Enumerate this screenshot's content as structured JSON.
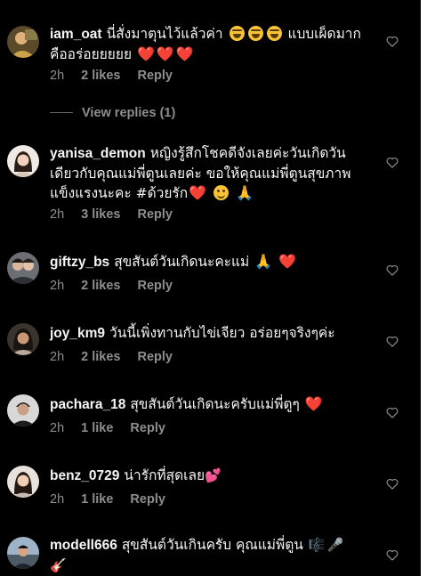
{
  "comments": [
    {
      "username": "iam_oat",
      "text_part1": "นี่สั่งมาตุนไว้แล้วค่า",
      "text_part2": "แบบเผ็ดมาก",
      "text_part3": "คืออร่อยยยยย",
      "time": "2h",
      "likes": "2 likes",
      "reply": "Reply",
      "emojis": [
        "laughing-face",
        "laughing-face",
        "laughing-face",
        "red-heart",
        "red-heart",
        "red-heart"
      ]
    },
    {
      "username": "yanisa_demon",
      "text_part1": "หญิงรู้สึกโชคดีจังเลยค่ะวันเกิดวันเดียวกับคุณแม่พี่ตูนเลยค่ะ ขอให้คุณแม่พี่ตูนสุขภาพแข็งแรงนะคะ #ด้วยรัก",
      "time": "2h",
      "likes": "3 likes",
      "reply": "Reply",
      "emojis": [
        "red-heart",
        "smiling-face",
        "folded-hands"
      ]
    },
    {
      "username": "giftzy_bs",
      "text_part1": "สุขสันต์วันเกิดนะคะแม่",
      "time": "2h",
      "likes": "2 likes",
      "reply": "Reply",
      "emojis": [
        "folded-hands",
        "red-heart"
      ]
    },
    {
      "username": "joy_km9",
      "text_part1": "วันนี้เพิ่งทานกับไข่เจียว อร่อยๆจริงๆค่ะ",
      "time": "2h",
      "likes": "2 likes",
      "reply": "Reply"
    },
    {
      "username": "pachara_18",
      "text_part1": "สุขสันต์วันเกิดนะครับแม่พี่ตูๆ",
      "time": "2h",
      "likes": "1 like",
      "reply": "Reply",
      "emojis": [
        "red-heart"
      ]
    },
    {
      "username": "benz_0729",
      "text_part1": "น่ารักที่สุดเลย",
      "time": "2h",
      "likes": "1 like",
      "reply": "Reply",
      "emojis": [
        "sparkling-heart"
      ]
    },
    {
      "username": "modell666",
      "text_part1": "สุขสันต์วันเกินครับ คุณแม่พี่ตูน",
      "emojis": [
        "musical-score",
        "microphone",
        "guitar"
      ]
    }
  ],
  "view_replies": "View replies (1)",
  "glyphs": {
    "red_heart": "❤️",
    "folded_hands": "🙏",
    "sparkling_heart": "💕",
    "musical_score": "🎼",
    "microphone": "🎤",
    "guitar": "🎸"
  },
  "colors": {
    "background": "#000000",
    "text": "#f5f5f5",
    "meta": "#8e8e8e"
  }
}
